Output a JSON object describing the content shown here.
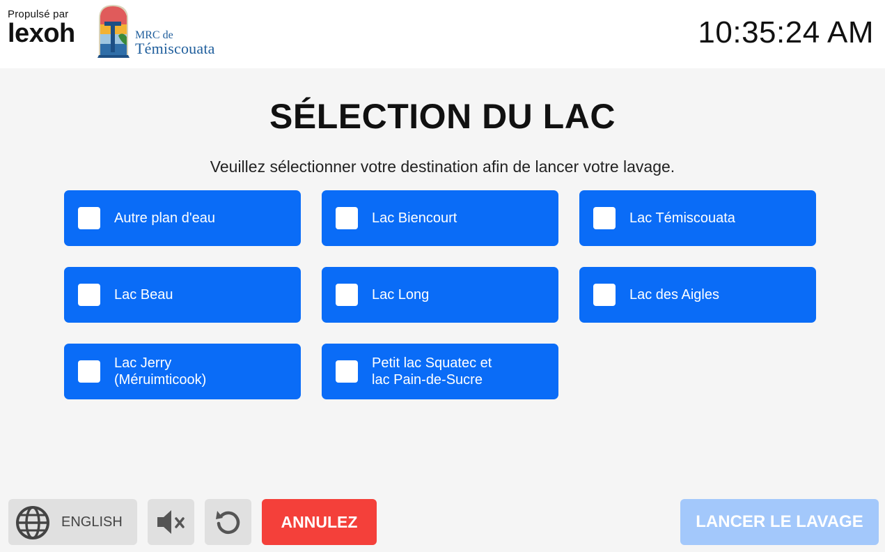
{
  "header": {
    "powered_label": "Propulsé par",
    "powered_brand": "lexoh",
    "mrc_small": "MRC de",
    "mrc_big": "Témiscouata",
    "clock": "10:35:24 AM"
  },
  "main": {
    "title": "SÉLECTION DU LAC",
    "subtitle": "Veuillez sélectionner votre destination afin de lancer votre lavage.",
    "lakes": [
      {
        "label": "Autre plan d'eau",
        "checked": false
      },
      {
        "label": "Lac Biencourt",
        "checked": false
      },
      {
        "label": "Lac Témiscouata",
        "checked": false
      },
      {
        "label": "Lac Beau",
        "checked": false
      },
      {
        "label": "Lac Long",
        "checked": false
      },
      {
        "label": "Lac des Aigles",
        "checked": false
      },
      {
        "label": "Lac Jerry\n(Méruimticook)",
        "checked": false
      },
      {
        "label": "Petit lac Squatec et\nlac Pain-de-Sucre",
        "checked": false
      }
    ]
  },
  "footer": {
    "language_label": "ENGLISH",
    "language_icon": "globe-icon",
    "mute_icon": "speaker-muted-icon",
    "reset_icon": "refresh-icon",
    "cancel_label": "ANNULEZ",
    "launch_label": "LANCER LE LAVAGE",
    "launch_enabled": false
  },
  "colors": {
    "lake_button": "#0a6cf7",
    "cancel": "#f4403a",
    "launch_disabled": "#a3c8fb",
    "background": "#f5f5f5"
  }
}
